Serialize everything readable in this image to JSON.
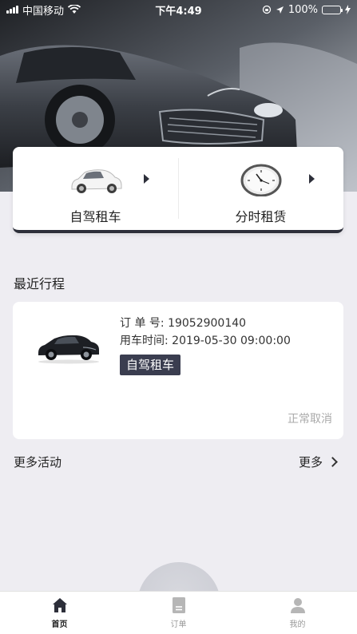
{
  "status_bar": {
    "carrier": "中国移动",
    "time": "下午4:49",
    "battery": "100%"
  },
  "services": [
    {
      "label": "自驾租车",
      "icon": "car-icon"
    },
    {
      "label": "分时租赁",
      "icon": "clock-icon"
    }
  ],
  "recent": {
    "title": "最近行程",
    "order_label": "订 单 号:",
    "order_no": "19052900140",
    "time_label": "用车时间:",
    "time_value": "2019-05-30 09:00:00",
    "badge": "自驾租车",
    "status": "正常取消"
  },
  "activities": {
    "title": "更多活动",
    "more": "更多"
  },
  "tabs": [
    {
      "label": "首页",
      "icon": "home-icon",
      "active": true
    },
    {
      "label": "订单",
      "icon": "order-icon",
      "active": false
    },
    {
      "label": "我的",
      "icon": "profile-icon",
      "active": false
    }
  ],
  "colors": {
    "accent": "#2d2f3a",
    "badge_bg": "#3a3d4f",
    "page_bg": "#eeedf2",
    "muted": "#aaaaaa"
  }
}
